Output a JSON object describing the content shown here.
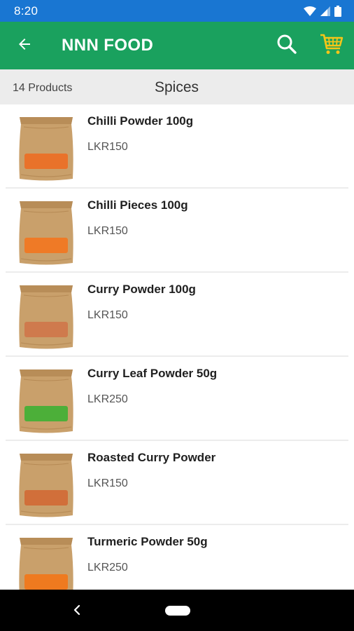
{
  "status_bar": {
    "time": "8:20",
    "icons": [
      "wifi-icon",
      "signal-icon",
      "battery-icon"
    ]
  },
  "app_bar": {
    "title": "NNN FOOD",
    "back_icon": "arrow-left-icon",
    "search_icon": "search-icon",
    "cart_icon": "cart-icon",
    "background_color": "#1aa15e",
    "cart_color": "#f5c518"
  },
  "category": {
    "count": "14 Products",
    "title": "Spices"
  },
  "products": [
    {
      "name": "Chilli Powder 100g",
      "price": "LKR150",
      "color": "#e9722a"
    },
    {
      "name": "Chilli Pieces 100g",
      "price": "LKR150",
      "color": "#ef7a26"
    },
    {
      "name": "Curry Powder 100g",
      "price": "LKR150",
      "color": "#cf7a4d"
    },
    {
      "name": "Curry Leaf Powder 50g",
      "price": "LKR250",
      "color": "#4caf39"
    },
    {
      "name": "Roasted Curry Powder",
      "price": "LKR150",
      "color": "#d16f3a"
    },
    {
      "name": "Turmeric Powder 50g",
      "price": "LKR250",
      "color": "#ef7a1f"
    }
  ],
  "nav_bar": {
    "back_icon": "nav-back-icon",
    "home_icon": "nav-home-pill"
  }
}
